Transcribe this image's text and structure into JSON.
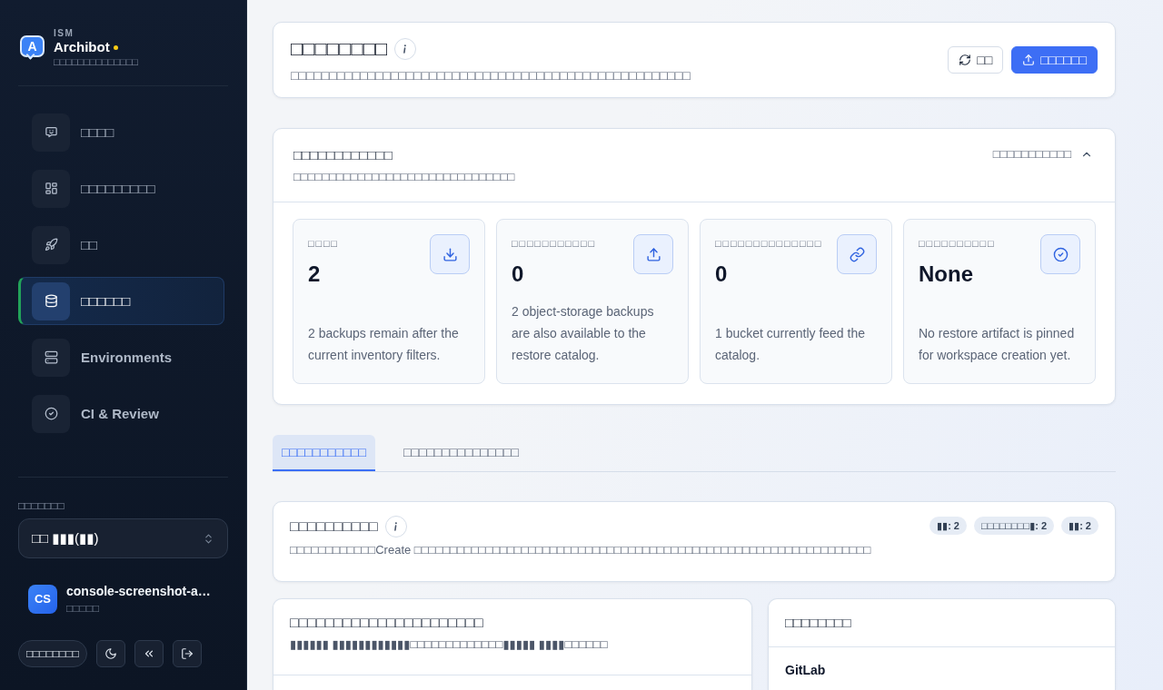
{
  "sidebar": {
    "brand": {
      "logo_letter": "A",
      "overline": "ISM",
      "name": "Archibot",
      "tagline": "□□□□□□□□□□□□□□"
    },
    "nav": [
      {
        "label": "□□□□",
        "selected": false
      },
      {
        "label": "□□□□□□□□□",
        "selected": false
      },
      {
        "label": "□□",
        "selected": false
      },
      {
        "label": "□□□□□□",
        "selected": true
      },
      {
        "label": "Environments",
        "selected": false
      },
      {
        "label": "CI & Review",
        "selected": false
      }
    ],
    "workspace_label": "□□□□□□□",
    "workspace_select": {
      "value": "□□ ▮▮▮(▮▮)"
    },
    "user": {
      "initials": "CS",
      "name": "console-screenshot-a…",
      "role": "□□□□□"
    },
    "language_button": "□□□□□□□□"
  },
  "header": {
    "title": "□□□□□□□□",
    "subtitle": "□□□□□□□□□□□□□□□□□□□□□□□□□□□□□□□□□□□□□□□□□□□□□□□□□□□□",
    "buttons": [
      {
        "kind": "secondary",
        "label": "□□"
      },
      {
        "kind": "primary",
        "label": "□□□□□□"
      }
    ]
  },
  "summary": {
    "title": "□□□□□□□□□□□□",
    "subtitle": "□□□□□□□□□□□□□□□□□□□□□□□□□□□□□□□",
    "toggle_label": "□□□□□□□□□□□",
    "expanded": true,
    "stats": [
      {
        "label": "□□□□",
        "value": "2",
        "description": "2 backups remain after the current inventory filters."
      },
      {
        "label": "□□□□□□□□□□□",
        "value": "0",
        "description": "2 object-storage backups are also available to the restore catalog."
      },
      {
        "label": "□□□□□□□□□□□□□□",
        "value": "0",
        "description": "1 bucket currently feed the catalog."
      },
      {
        "label": "□□□□□□□□□□",
        "value": "None",
        "description": "No restore artifact is pinned for workspace creation yet."
      }
    ]
  },
  "tabs": [
    {
      "label": "□□□□□□□□□□□",
      "selected": true
    },
    {
      "label": "□□□□□□□□□□□□□□□",
      "selected": false
    }
  ],
  "inventory": {
    "title": "□□□□□□□□□□",
    "badges": [
      "▮▮: 2",
      "□□□□□□□□▮: 2",
      "▮▮: 2"
    ],
    "description": "□□□□□□□□□□□□Create □□□□□□□□□□□□□□□□□□□□□□□□□□□□□□□□□□□□□□□□□□□□□□□□□□□□□□□□□□□□□□□□"
  },
  "backup_list": {
    "title": "□□□□□□□□□□□□□□□□□□□□□□",
    "subtitle": "▮▮▮▮▮▮ ▮▮▮▮▮▮▮▮▮▮▮▮□□□□□□□□□□□□□▮▮▮▮▮ ▮▮▮▮□□□□□□"
  },
  "sources": {
    "title": "□□□□□□□□",
    "items": [
      {
        "name": "GitLab"
      }
    ]
  }
}
